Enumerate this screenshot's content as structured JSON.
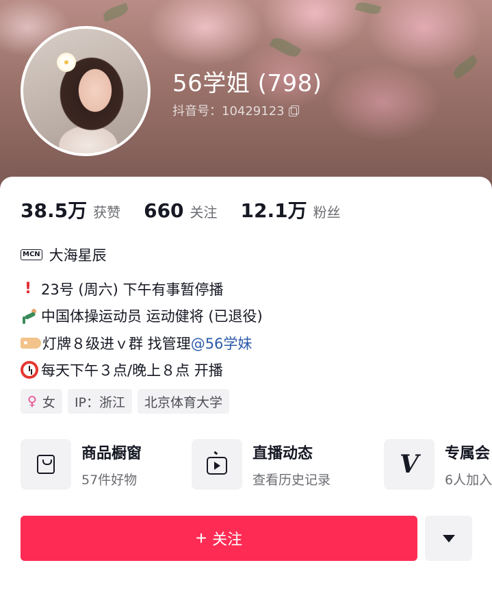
{
  "profile": {
    "name": "56学姐 (798)",
    "douyin_id": "抖音号：10429123",
    "avatar_icon": "avatar-photo"
  },
  "stats": [
    {
      "value": "38.5万",
      "label": "获赞"
    },
    {
      "value": "660",
      "label": "关注"
    },
    {
      "value": "12.1万",
      "label": "粉丝"
    }
  ],
  "mcn": {
    "badge": "MCN",
    "name": "大海星辰"
  },
  "bio": {
    "line1": "23号 (周六) 下午有事暂停播",
    "line2": "中国体操运动员 运动健将 (已退役)",
    "line3_text": "灯牌８级进ｖ群 找管理",
    "line3_mention": "@56学妹",
    "line4": "每天下午３点/晚上８点 开播"
  },
  "chips": {
    "gender": "女",
    "ip": "IP：浙江",
    "school": "北京体育大学"
  },
  "features": [
    {
      "title": "商品橱窗",
      "sub": "57件好物",
      "icon": "shopping-bag-icon"
    },
    {
      "title": "直播动态",
      "sub": "查看历史记录",
      "icon": "tv-icon"
    },
    {
      "title": "专属会",
      "sub": "6人加入",
      "icon": "v-badge-icon"
    }
  ],
  "actions": {
    "follow_label": "关注",
    "follow_color": "#fe2c55"
  }
}
